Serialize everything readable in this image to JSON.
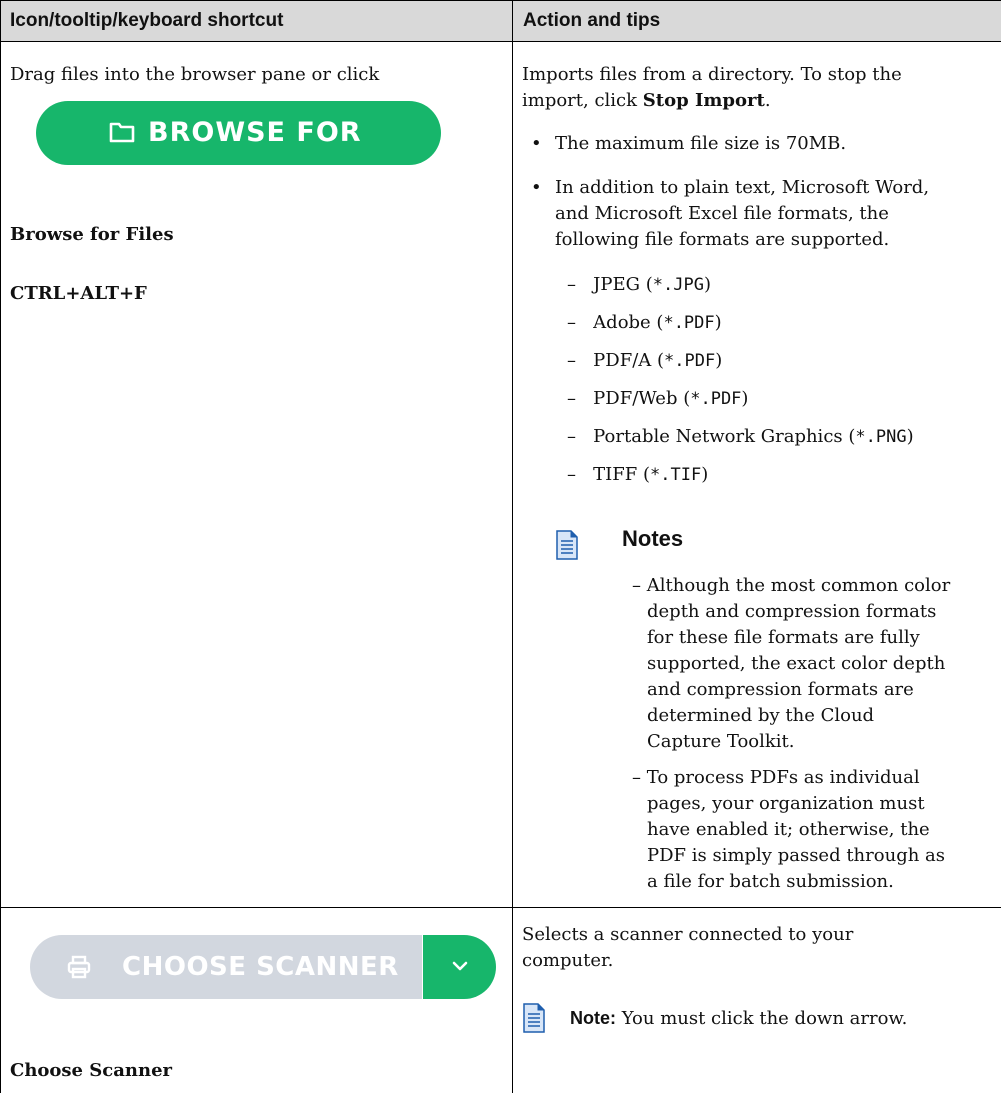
{
  "table": {
    "headers": [
      "Icon/tooltip/keyboard shortcut",
      "Action and tips"
    ]
  },
  "row1": {
    "left_intro": "Drag files into the browser pane or click",
    "button_label": "BROWSE FOR FILES",
    "button_icon": "folder-icon",
    "tooltip": "Browse for Files",
    "shortcut": "CTRL+ALT+F",
    "action_line1": "Imports files from a directory. To stop the",
    "action_line2_prefix": "import, click ",
    "action_line2_bold": "Stop Import",
    "action_line2_suffix": ".",
    "bullets": [
      [
        "The maximum file size is 70MB."
      ],
      [
        "In addition to plain text, Microsoft Word,",
        "and Microsoft Excel file formats, the",
        "following file formats are supported."
      ]
    ],
    "formats": [
      {
        "name": "JPEG (",
        "ext": "*.JPG",
        "close": ")"
      },
      {
        "name": "Adobe (",
        "ext": "*.PDF",
        "close": ")"
      },
      {
        "name": "PDF/A (",
        "ext": "*.PDF",
        "close": ")"
      },
      {
        "name": "PDF/Web (",
        "ext": "*.PDF",
        "close": ")"
      },
      {
        "name": "Portable Network Graphics (",
        "ext": "*.PNG",
        "close": ")"
      },
      {
        "name": "TIFF (",
        "ext": "*.TIF",
        "close": ")"
      }
    ],
    "notes_title": "Notes",
    "notes": [
      [
        "Although the most common color",
        "depth and compression formats",
        "for these file formats are fully",
        "supported, the exact color depth",
        "and compression formats are",
        "determined by the Cloud",
        "Capture Toolkit."
      ],
      [
        "To process PDFs as individual",
        "pages, your organization must",
        "have enabled it; otherwise, the",
        "PDF is simply passed through as",
        "a file for batch submission."
      ]
    ]
  },
  "row2": {
    "button_label": "CHOOSE SCANNER",
    "button_icon": "printer-icon",
    "dropdown_icon": "chevron-down-icon",
    "tooltip": "Choose Scanner",
    "action_line1": "Selects a scanner connected to your",
    "action_line2": "computer.",
    "note_label": "Note:",
    "note_text": " You must click the down arrow."
  },
  "colors": {
    "header_bg": "#d9d9d9",
    "button_green": "#17b66b",
    "button_disabled": "#d2d7df"
  }
}
